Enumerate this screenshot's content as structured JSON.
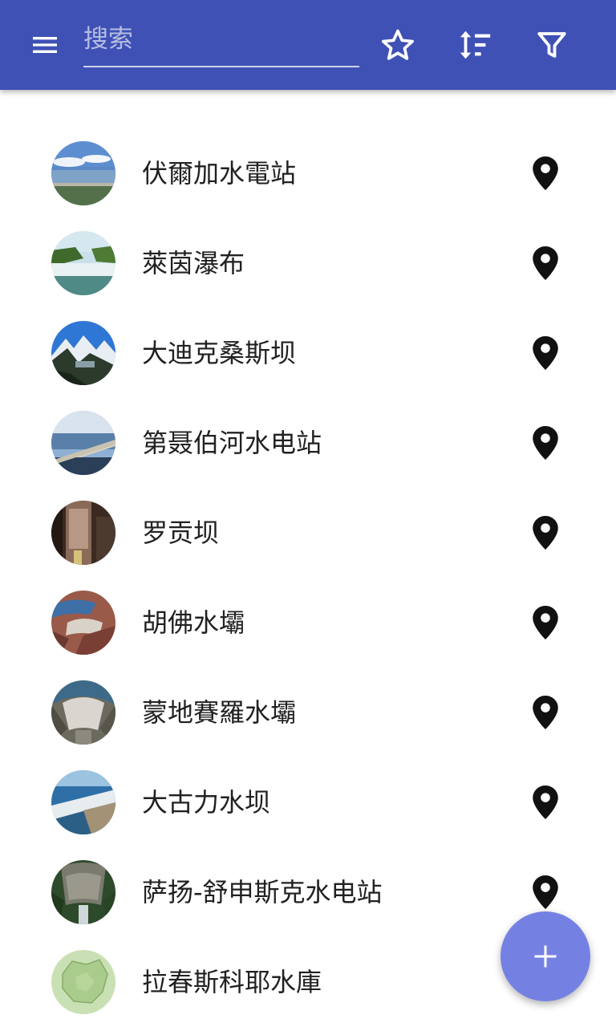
{
  "toolbar": {
    "search_placeholder": "搜索",
    "background": "#3f51b5"
  },
  "icons": {
    "menu": "menu-icon",
    "favorites": "star-outline-icon",
    "sort": "sort-icon",
    "filter": "filter-icon",
    "location": "map-pin-icon",
    "add": "plus-icon"
  },
  "items": [
    {
      "name": "伏爾加水電站"
    },
    {
      "name": "萊茵瀑布"
    },
    {
      "name": "大迪克桑斯坝"
    },
    {
      "name": "第聂伯河水电站"
    },
    {
      "name": "罗贡坝"
    },
    {
      "name": "胡佛水壩"
    },
    {
      "name": "蒙地賽羅水壩"
    },
    {
      "name": "大古力水坝"
    },
    {
      "name": "萨扬-舒申斯克水电站"
    },
    {
      "name": "拉春斯科耶水庫"
    }
  ],
  "fab": {
    "color": "#7581e2"
  }
}
